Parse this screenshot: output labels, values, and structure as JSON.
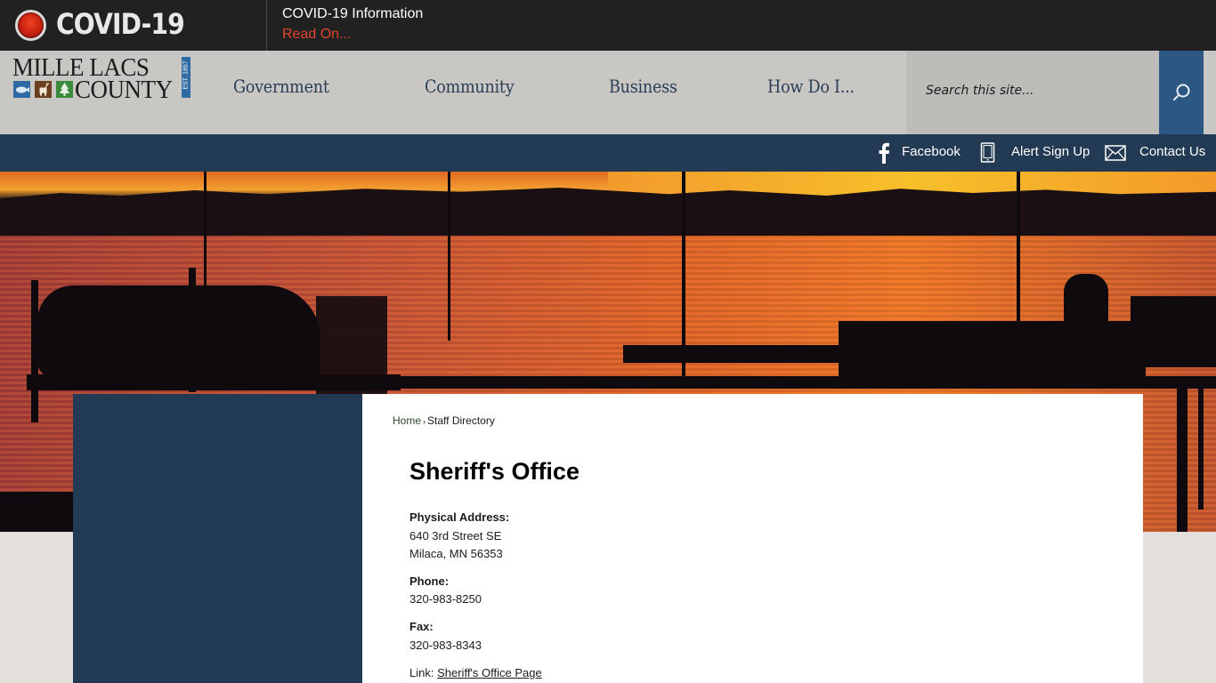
{
  "covid": {
    "title": "COVID-19",
    "info": "COVID-19 Information",
    "read_on": "Read On..."
  },
  "logo": {
    "line1": "MILLE LACS",
    "line2": "COUNTY",
    "est": "EST. 1857"
  },
  "nav": {
    "items": [
      {
        "label": "Government"
      },
      {
        "label": "Community"
      },
      {
        "label": "Business"
      },
      {
        "label": "How Do I..."
      }
    ]
  },
  "search": {
    "placeholder": "Search this site...",
    "value": ""
  },
  "utility": {
    "facebook": "Facebook",
    "alert": "Alert Sign Up",
    "contact": "Contact Us"
  },
  "breadcrumb": {
    "home": "Home",
    "separator": "›",
    "current": "Staff Directory"
  },
  "page": {
    "title": "Sheriff's Office",
    "address_label": "Physical Address:",
    "address_line1": "640 3rd Street SE",
    "address_line2": "Milaca, MN 56353",
    "phone_label": "Phone:",
    "phone": "320-983-8250",
    "fax_label": "Fax:",
    "fax": "320-983-8343",
    "link_label": "Link:",
    "link_text": "Sheriff's Office Page"
  },
  "colors": {
    "covid_bar": "#212121",
    "read_on": "#e0452c",
    "header_bg": "#c9c7c4",
    "nav_text": "#2b3d55",
    "search_button": "#2d5783",
    "utility_bar": "#233a55",
    "page_bg": "#e3dfdc"
  }
}
